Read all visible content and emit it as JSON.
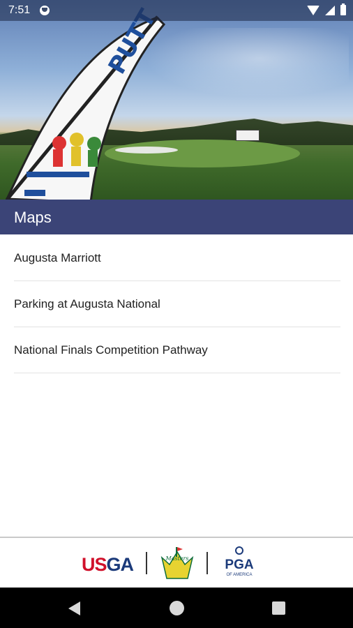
{
  "status_bar": {
    "time": "7:51"
  },
  "hero": {
    "banner_text": "PUTT"
  },
  "header": {
    "title": "Maps"
  },
  "list": {
    "items": [
      {
        "label": "Augusta Marriott"
      },
      {
        "label": "Parking at Augusta National"
      },
      {
        "label": "National Finals Competition Pathway"
      }
    ]
  },
  "sponsors": {
    "usga_us": "US",
    "usga_ga": "GA",
    "masters": "Masters",
    "pga": "PGA",
    "pga_sub": "OF AMERICA"
  },
  "colors": {
    "header_bg": "#3b4477",
    "usga_red": "#d0112b",
    "usga_blue": "#1b3a7a",
    "masters_green": "#0b6b3a",
    "masters_yellow": "#e7d331"
  },
  "icons": [
    "wifi-icon",
    "cell-signal-icon",
    "battery-icon",
    "back-icon",
    "home-icon",
    "recent-apps-icon"
  ]
}
